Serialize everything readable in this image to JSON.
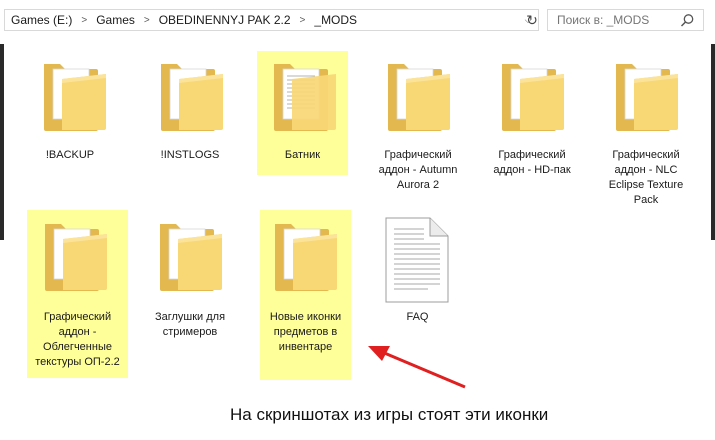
{
  "address_bar": {
    "crumbs": [
      "Games (E:)",
      "Games",
      "OBEDINENNYJ PAK 2.2",
      "_MODS"
    ]
  },
  "search": {
    "placeholder": "Поиск в: _MODS"
  },
  "items": [
    {
      "label": "!BACKUP",
      "type": "folder",
      "icon": "folder-icon",
      "highlighted": false
    },
    {
      "label": "!INSTLOGS",
      "type": "folder",
      "icon": "folder-icon",
      "highlighted": false
    },
    {
      "label": "Батник",
      "type": "folder",
      "icon": "folder-icon",
      "highlighted": true
    },
    {
      "label": "Графический аддон - Autumn Aurora 2",
      "type": "folder",
      "icon": "folder-icon",
      "highlighted": false
    },
    {
      "label": "Графический аддон - HD-пак",
      "type": "folder",
      "icon": "folder-icon",
      "highlighted": false
    },
    {
      "label": "Графический аддон - NLC Eclipse Texture Pack",
      "type": "folder",
      "icon": "folder-icon",
      "highlighted": false
    },
    {
      "label": "Графический аддон - Облегченные текстуры ОП-2.2",
      "type": "folder",
      "icon": "folder-icon",
      "highlighted": true
    },
    {
      "label": "Заглушки для стримеров",
      "type": "folder",
      "icon": "folder-icon",
      "highlighted": false
    },
    {
      "label": "Новые иконки предметов в инвентаре",
      "type": "folder",
      "icon": "folder-icon",
      "highlighted": true
    },
    {
      "label": "FAQ",
      "type": "file",
      "icon": "text-file-icon",
      "highlighted": false
    }
  ],
  "annotation": {
    "caption": "На скриншотах из игры стоят эти иконки",
    "highlight_color": "#ffff99",
    "arrow_color": "#e02020"
  }
}
